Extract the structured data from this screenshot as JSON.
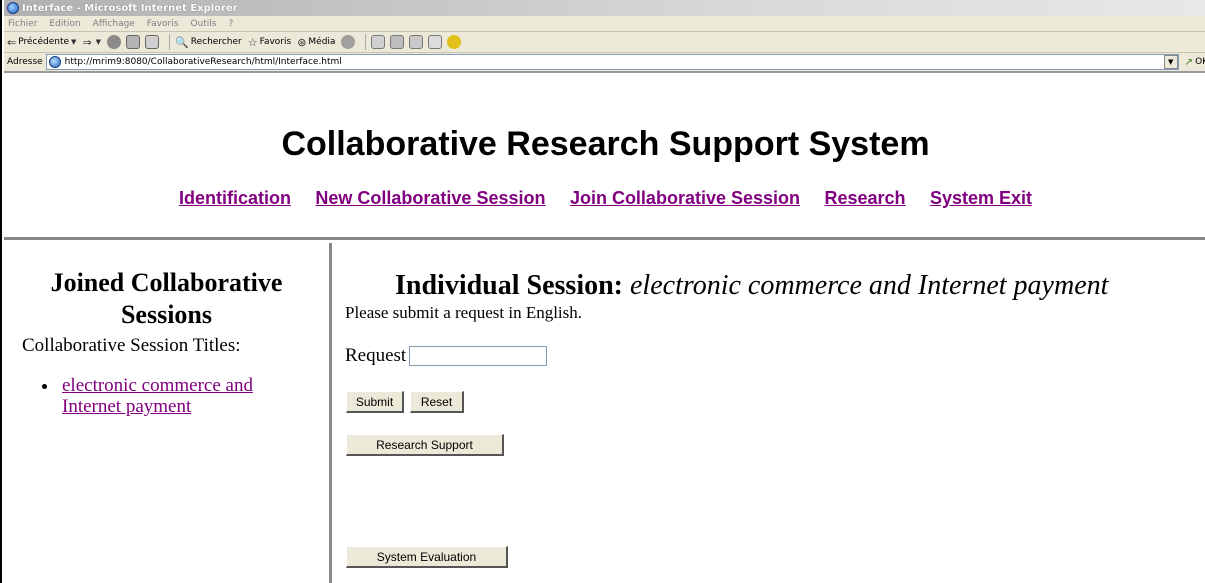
{
  "window": {
    "title": "Interface - Microsoft Internet Explorer"
  },
  "menu": {
    "items": [
      "Fichier",
      "Edition",
      "Affichage",
      "Favoris",
      "Outils",
      "?"
    ]
  },
  "toolbar": {
    "back_label": "Précédente",
    "search_label": "Rechercher",
    "favorites_label": "Favoris",
    "media_label": "Média"
  },
  "address": {
    "label": "Adresse",
    "url": "http://mrim9:8080/CollaborativeResearch/html/Interface.html",
    "go_label": "OK"
  },
  "header": {
    "title": "Collaborative Research Support System",
    "nav": [
      "Identification",
      "New Collaborative Session",
      "Join Collaborative Session",
      "Research",
      "System Exit"
    ]
  },
  "left": {
    "heading_line1": "Joined Collaborative",
    "heading_line2": "Sessions",
    "subtitle": "Collaborative Session Titles:",
    "sessions": [
      "electronic commerce and Internet payment"
    ]
  },
  "right": {
    "heading_label": "Individual Session:",
    "heading_topic": "electronic commerce and Internet payment",
    "instruction": "Please submit a request in English.",
    "request_label": "Request",
    "request_value": "",
    "submit_label": "Submit",
    "reset_label": "Reset",
    "research_support_label": "Research Support",
    "system_evaluation_label": "System Evaluation"
  },
  "colors": {
    "visited_link": "#800080",
    "chrome": "#ece9d8"
  }
}
